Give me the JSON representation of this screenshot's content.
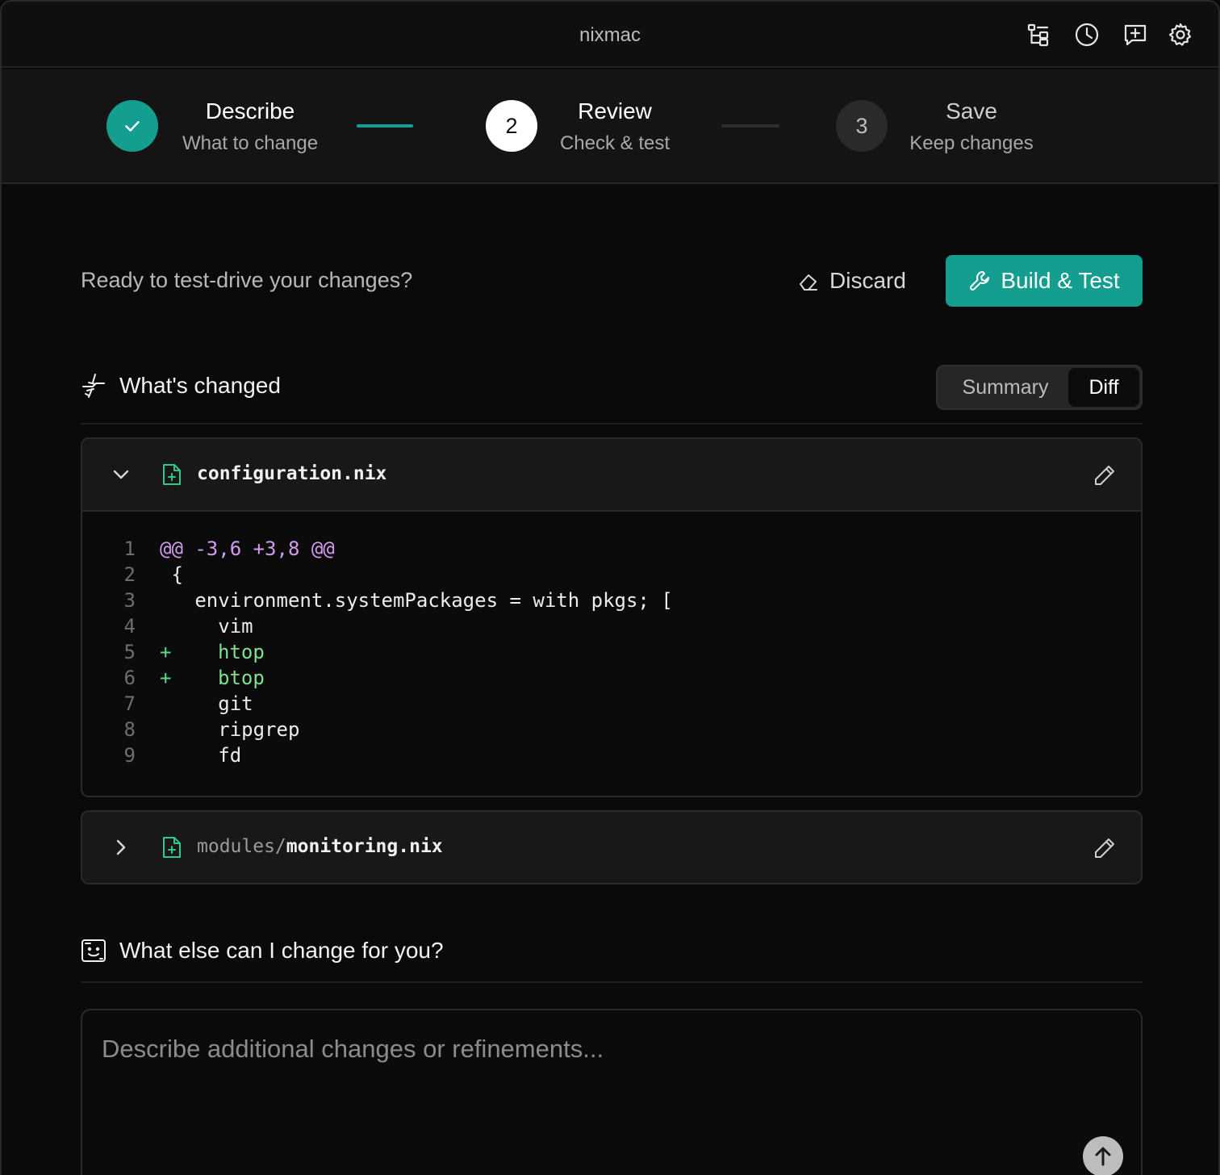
{
  "app": {
    "title": "nixmac"
  },
  "titlebar_icons": [
    "tree-structure-icon",
    "history-clock-icon",
    "feedback-plus-icon",
    "settings-gear-icon"
  ],
  "colors": {
    "accent": "#139e8f",
    "added": "#7fe08e",
    "hunk": "#d49cf0",
    "file_icon": "#2fc98a"
  },
  "stepper": {
    "steps": [
      {
        "marker": "",
        "title": "Describe",
        "subtitle": "What to change",
        "state": "completed"
      },
      {
        "marker": "2",
        "title": "Review",
        "subtitle": "Check & test",
        "state": "active"
      },
      {
        "marker": "3",
        "title": "Save",
        "subtitle": "Keep changes",
        "state": "pending"
      }
    ]
  },
  "actions": {
    "prompt": "Ready to test-drive your changes?",
    "discard_label": "Discard",
    "build_label": "Build & Test"
  },
  "changes": {
    "heading": "What's changed",
    "view_toggle": {
      "options": [
        "Summary",
        "Diff"
      ],
      "selected": "Diff"
    },
    "files": [
      {
        "dir": "",
        "name": "configuration.nix",
        "expanded": true,
        "diff": [
          {
            "num": "1",
            "marker": "",
            "text": "@@ -3,6 +3,8 @@",
            "kind": "hunk"
          },
          {
            "num": "2",
            "marker": "",
            "text": " {",
            "kind": "context"
          },
          {
            "num": "3",
            "marker": "",
            "text": "   environment.systemPackages = with pkgs; [",
            "kind": "context"
          },
          {
            "num": "4",
            "marker": "",
            "text": "     vim",
            "kind": "context"
          },
          {
            "num": "5",
            "marker": "+",
            "text": "htop",
            "kind": "added"
          },
          {
            "num": "6",
            "marker": "+",
            "text": "btop",
            "kind": "added"
          },
          {
            "num": "7",
            "marker": "",
            "text": "     git",
            "kind": "context"
          },
          {
            "num": "8",
            "marker": "",
            "text": "     ripgrep",
            "kind": "context"
          },
          {
            "num": "9",
            "marker": "",
            "text": "     fd",
            "kind": "context"
          }
        ]
      },
      {
        "dir": "modules/",
        "name": "monitoring.nix",
        "expanded": false
      }
    ]
  },
  "followup": {
    "heading": "What else can I change for you?",
    "placeholder": "Describe additional changes or refinements..."
  }
}
